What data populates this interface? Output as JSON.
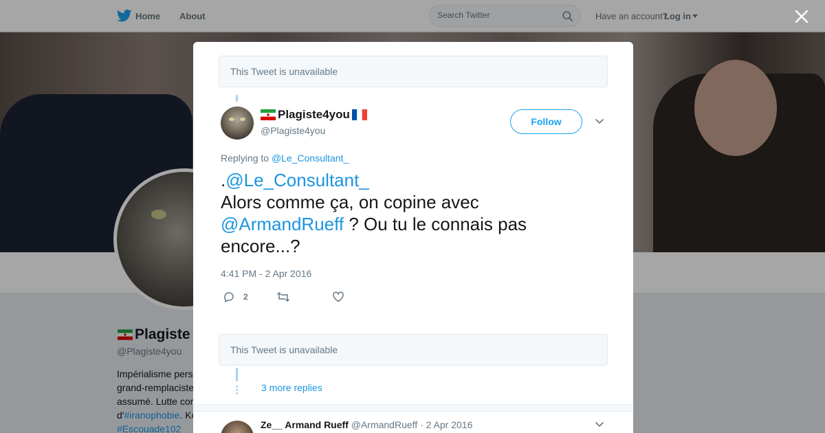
{
  "topbar": {
    "home_label": "Home",
    "about_label": "About",
    "search_placeholder": "Search Twitter",
    "have_account": "Have an account?",
    "login_label": "Log in"
  },
  "background_profile": {
    "name": "Plagiste",
    "handle": "@Plagiste4you",
    "bio_lines": [
      {
        "text": "Impérialisme pers"
      },
      {
        "text": "grand-remplaciste"
      },
      {
        "text": "assumé. Lutte cor"
      },
      {
        "prefix": "d'",
        "tag": "#iranophobie",
        "suffix": ". Ko"
      },
      {
        "tag": "#Escouade102"
      }
    ]
  },
  "modal": {
    "unavailable_top": "This Tweet is unavailable",
    "tweet": {
      "author_name": "Plagiste4you",
      "author_handle": "@Plagiste4you",
      "follow_label": "Follow",
      "replying_prefix": "Replying to",
      "replying_to": "@Le_Consultant_",
      "text": {
        "line1_prefix": ".",
        "line1_mention": "@Le_Consultant_",
        "line2": "Alors comme ça, on copine avec",
        "line3_mention": "@ArmandRueff",
        "line3_suffix": " ? Ou tu le connais pas",
        "line4": "encore...?"
      },
      "timestamp": "4:41 PM - 2 Apr 2016",
      "reply_count": "2"
    },
    "unavailable_bottom": "This Tweet is unavailable",
    "more_replies": "3 more replies",
    "reply": {
      "name": "Ze__ Armand Rueff",
      "handle": "@ArmandRueff",
      "separator": "·",
      "date": "2 Apr 2016"
    }
  },
  "colors": {
    "twitter_blue": "#1da1f2",
    "link_blue": "#1b95e0",
    "muted_gray": "#657786"
  },
  "icons": {
    "logo": "twitter-bird-icon",
    "search": "magnifier-icon",
    "close": "x-icon",
    "reply": "speech-bubble-icon",
    "retweet": "retweet-arrows-icon",
    "like": "heart-icon",
    "more": "chevron-down-icon"
  }
}
